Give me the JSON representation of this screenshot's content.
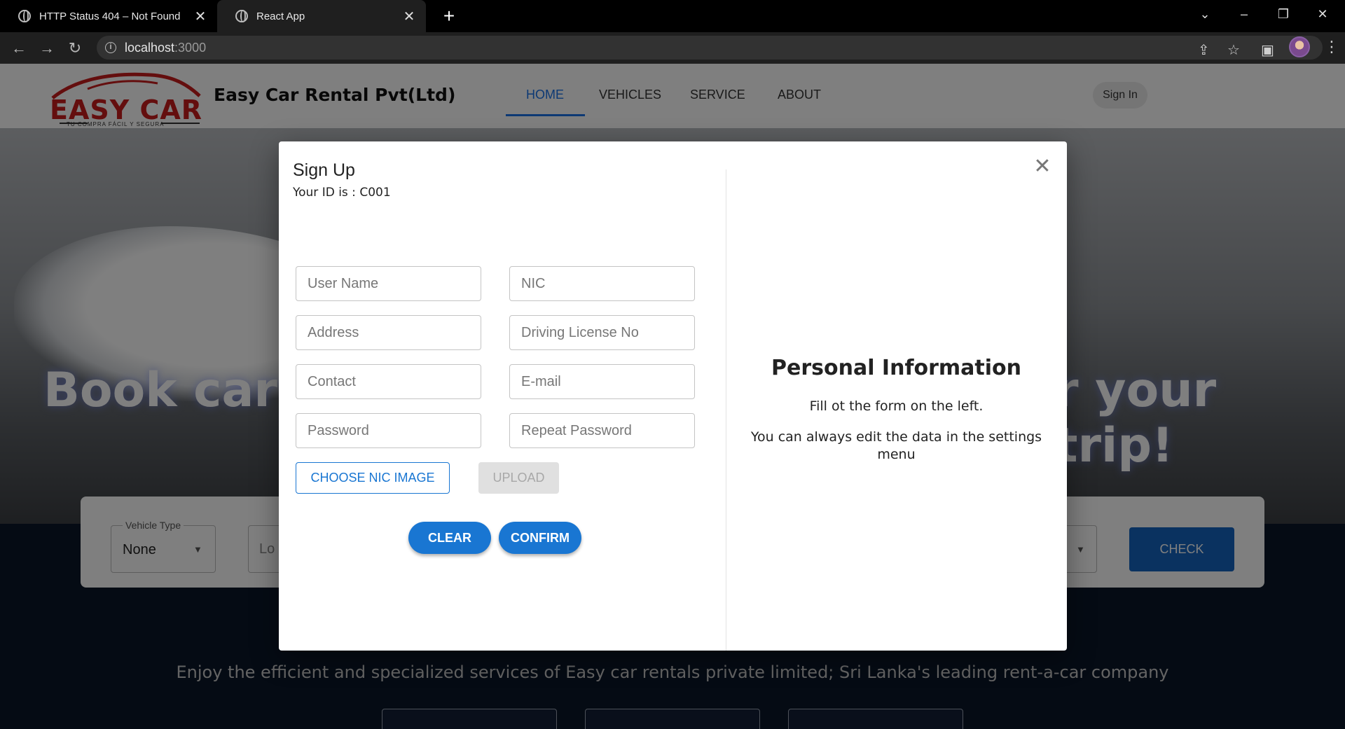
{
  "browser": {
    "tabs": [
      {
        "title": "HTTP Status 404 – Not Found"
      },
      {
        "title": "React App"
      }
    ],
    "url_host": "localhost",
    "url_port": ":3000"
  },
  "site": {
    "logo_text": "EASY CAR",
    "logo_tagline": "TU COMPRA FÁCIL Y SEGURA",
    "brand": "Easy Car Rental Pvt(Ltd)",
    "menu": [
      "HOME",
      "VEHICLES",
      "SERVICE",
      "ABOUT"
    ],
    "signin": "Sign In",
    "hero_left": "Book car h",
    "hero_right": "r your trip!",
    "search": {
      "vehicle_type_label": "Vehicle Type",
      "vehicle_type_value": "None",
      "location_placeholder": "Lo",
      "check": "CHECK"
    },
    "tagline": "Enjoy the efficient and specialized services of Easy car rentals private limited; Sri Lanka's leading rent-a-car company"
  },
  "modal": {
    "title": "Sign Up",
    "id_text": "Your ID is : C001",
    "fields": {
      "user_name": "User Name",
      "nic": "NIC",
      "address": "Address",
      "license": "Driving License No",
      "contact": "Contact",
      "email": "E-mail",
      "password": "Password",
      "repeat_password": "Repeat Password"
    },
    "choose_nic": "CHOOSE NIC IMAGE",
    "upload": "UPLOAD",
    "clear": "CLEAR",
    "confirm": "CONFIRM",
    "info_title": "Personal Information",
    "info_line1": "Fill ot the form on the left.",
    "info_line2": "You can always edit the data in the settings menu"
  },
  "colors": {
    "primary": "#1976d2",
    "backdrop": "rgba(0,0,0,0.5)"
  }
}
